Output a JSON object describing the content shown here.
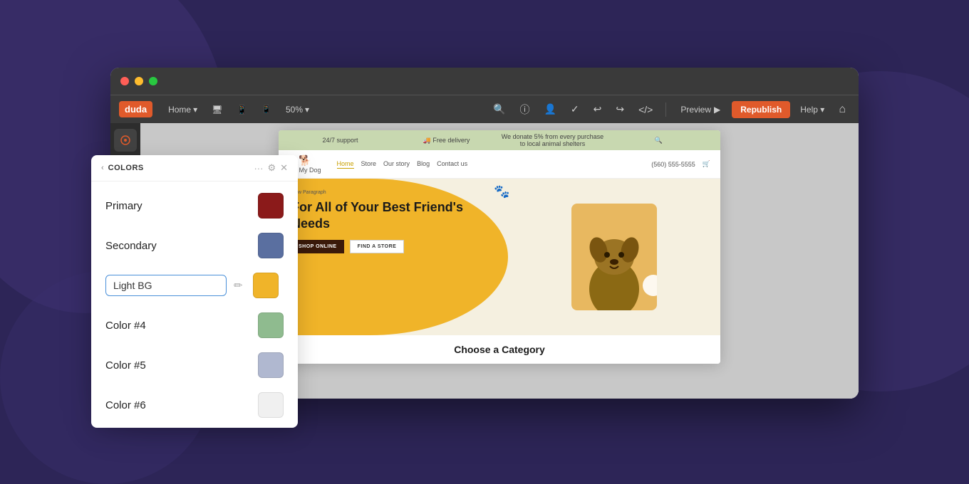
{
  "background": {
    "color": "#2d2557"
  },
  "browser": {
    "dots": [
      "red",
      "yellow",
      "green"
    ]
  },
  "toolbar": {
    "logo": "duda",
    "nav_items": [
      {
        "label": "Home",
        "has_arrow": true
      },
      {
        "label": "Desktop icon"
      },
      {
        "label": "Tablet icon"
      },
      {
        "label": "Mobile icon"
      },
      {
        "label": "50%",
        "has_arrow": true
      }
    ],
    "right_icons": [
      "search",
      "info",
      "person-circle",
      "checkmark",
      "undo",
      "redo",
      "code"
    ],
    "preview_label": "Preview",
    "republish_label": "Republish",
    "help_label": "Help",
    "home_icon": "⌂"
  },
  "sidebar": {
    "active_icon": "theme"
  },
  "colors_panel": {
    "title": "COLORS",
    "back_label": "COLORS",
    "colors": [
      {
        "label": "Primary",
        "value": "#8B1A1A",
        "editing": false
      },
      {
        "label": "Secondary",
        "value": "#5a6fa0",
        "editing": false
      },
      {
        "label": "Light BG",
        "value": "#f0b429",
        "editing": true,
        "input_value": "Light BG"
      },
      {
        "label": "Color #4",
        "value": "#8fbb8f",
        "editing": false
      },
      {
        "label": "Color #5",
        "value": "#b0b8d0",
        "editing": false
      },
      {
        "label": "Color #6",
        "value": "#f0f0f0",
        "editing": false
      }
    ]
  },
  "website": {
    "announcement_bar": [
      {
        "text": "24/7 support"
      },
      {
        "text": "🚚 Free delivery"
      },
      {
        "text": "We donate 5% from every purchase to local animal shelters"
      },
      {
        "text": "🔍"
      }
    ],
    "nav": {
      "logo_name": "Oh My Dog",
      "links": [
        "Home",
        "Store",
        "Our story",
        "Blog",
        "Contact us"
      ],
      "active_link": "Home",
      "phone": "(560) 555-5555",
      "cart_icon": "🛒"
    },
    "hero": {
      "tag": "New Paragraph",
      "title": "For All of Your Best Friend's Needs",
      "buttons": [
        {
          "label": "SHOP ONLINE"
        },
        {
          "label": "FIND A STORE"
        }
      ],
      "paw_icon": "🐾"
    },
    "category_section": {
      "title": "Choose a Category"
    }
  }
}
